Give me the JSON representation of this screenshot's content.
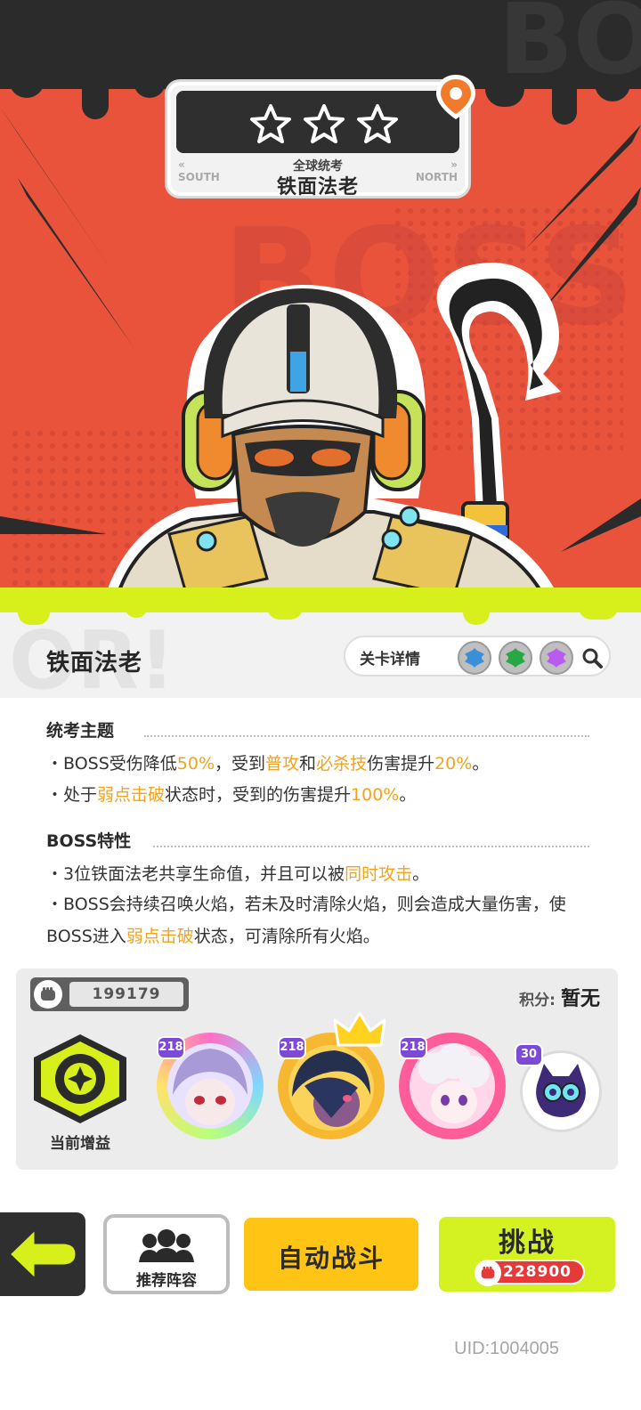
{
  "banner": {
    "stars": 3,
    "left_nav": "SOUTH",
    "right_nav": "NORTH",
    "subtitle": "全球统考",
    "title": "铁面法老"
  },
  "hero": {
    "bg_text": "BOSS"
  },
  "boss": {
    "name": "铁面法老"
  },
  "detail": {
    "label": "关卡详情",
    "elements": [
      {
        "name": "blue-element-icon",
        "color": "#3a8fd9"
      },
      {
        "name": "green-element-icon",
        "color": "#27a845"
      },
      {
        "name": "purple-element-icon",
        "color": "#b85cf0"
      }
    ]
  },
  "sections": {
    "theme": {
      "title": "统考主题",
      "line1": {
        "p1": "・BOSS受伤降低",
        "h1": "50%",
        "p2": "，受到",
        "h2": "普攻",
        "p3": "和",
        "h3": "必杀技",
        "p4": "伤害提升",
        "h4": "20%",
        "p5": "。"
      },
      "line2": {
        "p1": "・处于",
        "h1": "弱点击破",
        "p2": "状态时，受到的伤害提升",
        "h2": "100%",
        "p3": "。"
      }
    },
    "traits": {
      "title": "BOSS特性",
      "line1": {
        "p1": "・3位铁面法老共享生命值，并且可以被",
        "h1": "同时攻击",
        "p2": "。"
      },
      "line2": {
        "p1": "・BOSS会持续召唤火焰，若未及时清除火焰，则会造成大量伤害，使BOSS进入",
        "h1": "弱点击破",
        "p2": "状态，可清除所有火焰。"
      }
    }
  },
  "team": {
    "power": "199179",
    "score_label": "积分:",
    "score_value": "暂无",
    "buff_label": "当前增益",
    "members": [
      {
        "level": "218"
      },
      {
        "level": "218"
      },
      {
        "level": "218"
      },
      {
        "level": "30"
      }
    ]
  },
  "buttons": {
    "back": "BACK",
    "lineup": "推荐阵容",
    "auto": "自动战斗",
    "fight": "挑战",
    "fight_cost": "228900"
  },
  "footer": {
    "uid": "UID:1004005"
  },
  "colors": {
    "hero_red": "#e9533b",
    "lime": "#d7f01b",
    "highlight": "#f3a21b",
    "auto_yellow": "#ffc414",
    "cost_red": "#e63a3a"
  }
}
